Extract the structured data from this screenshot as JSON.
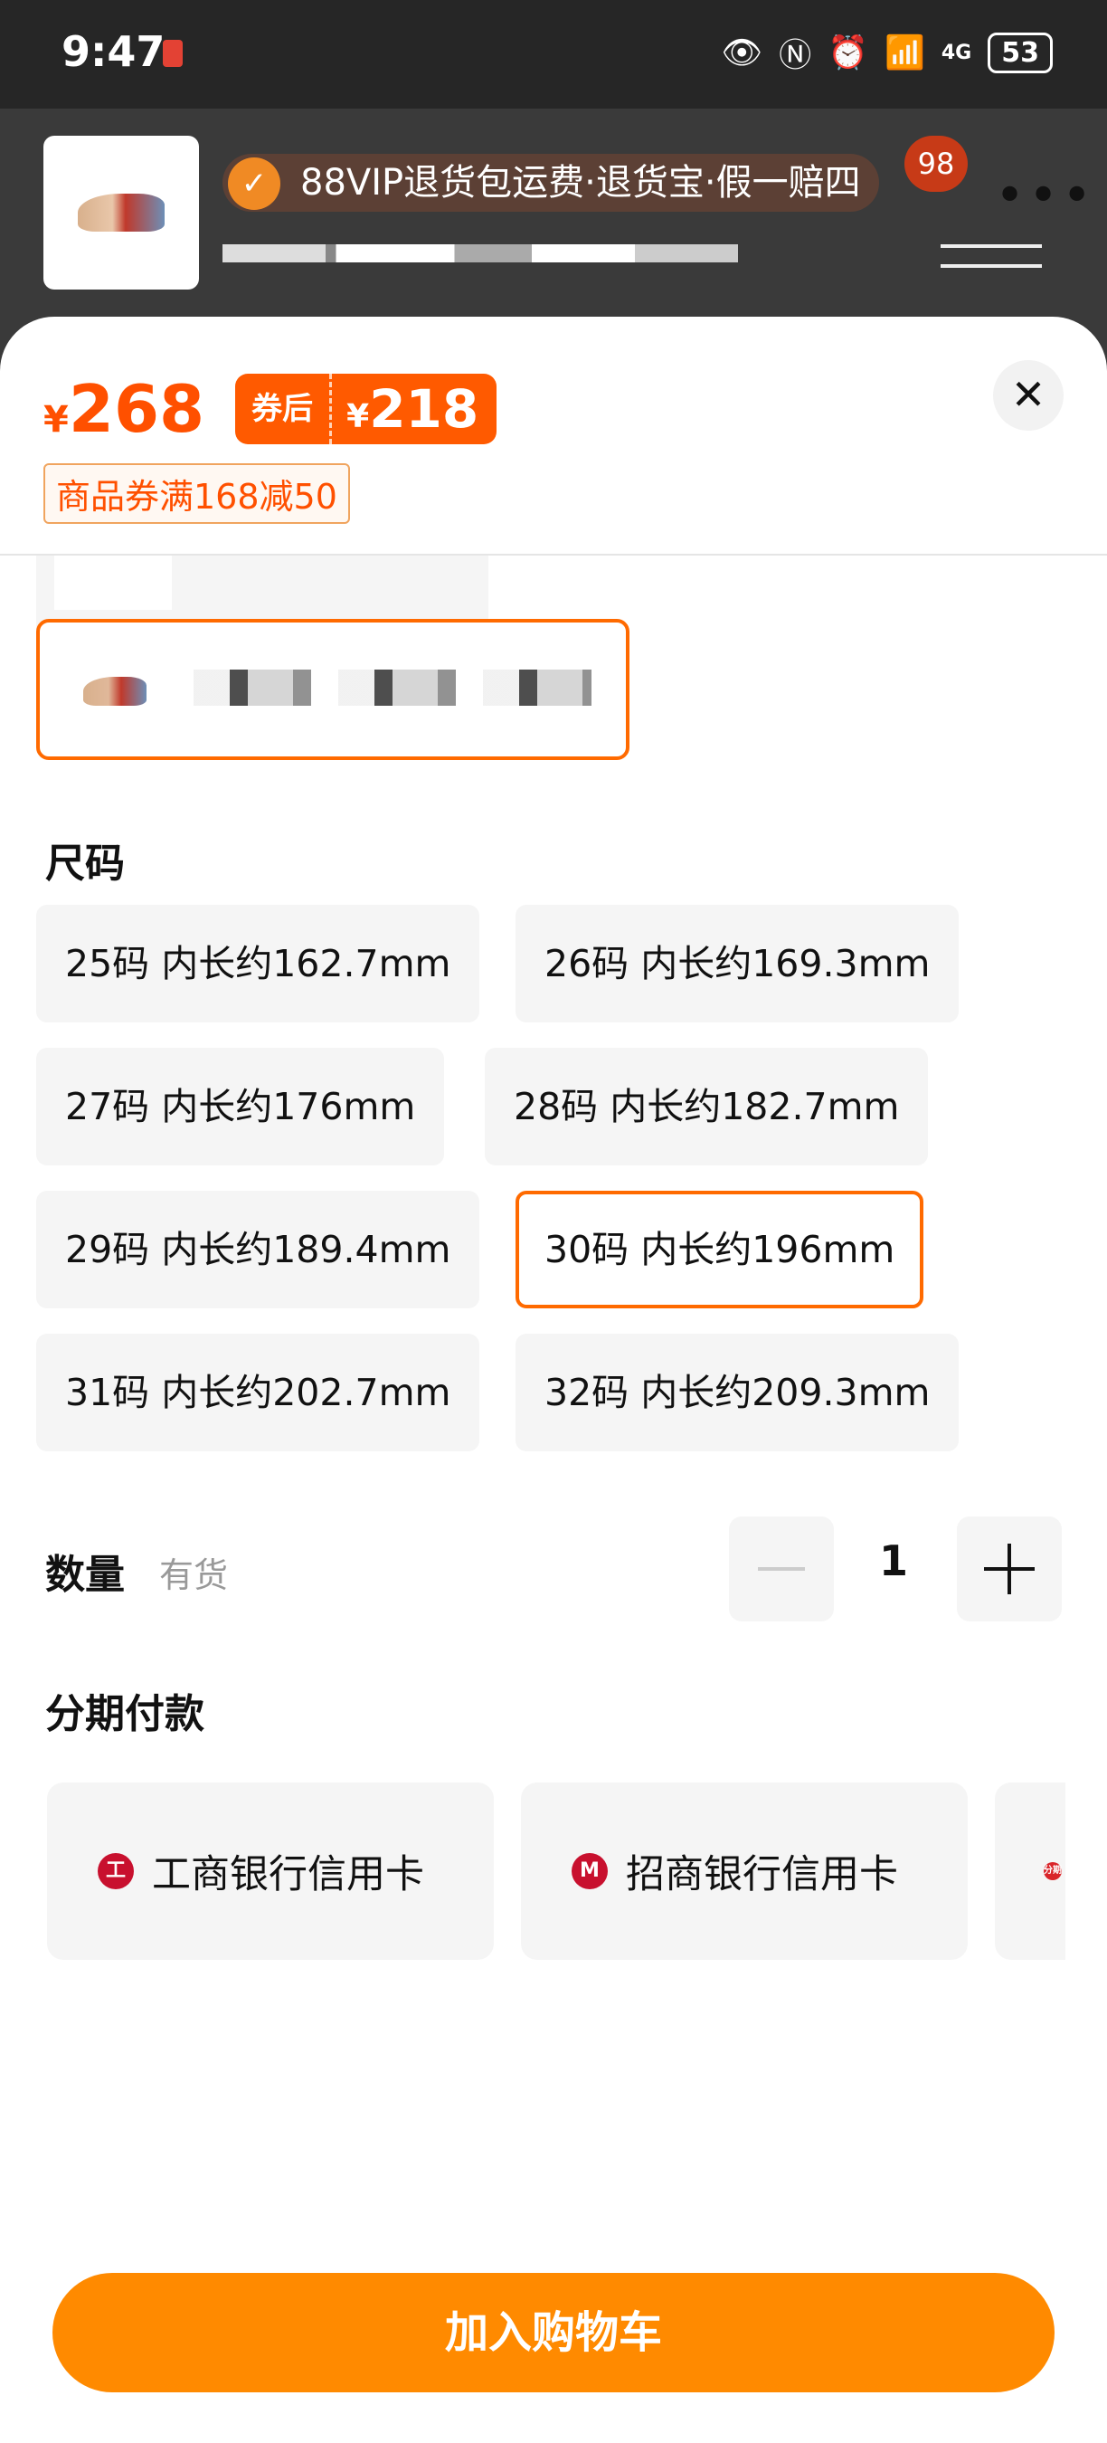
{
  "status_bar": {
    "time": "9:47",
    "battery": "53",
    "signal": "4G"
  },
  "header": {
    "vip_banner": "88VIP退货包运费·退货宝·假一赔四",
    "cart_count": "98"
  },
  "sheet": {
    "price": {
      "currency": "¥",
      "original": "268"
    },
    "coupon": {
      "label": "券后",
      "currency": "¥",
      "price": "218"
    },
    "coupon_note": "商品券满168减50",
    "close_label": "✕"
  },
  "size": {
    "title": "尺码",
    "options": [
      {
        "label": "25码 内长约162.7mm",
        "selected": false
      },
      {
        "label": "26码 内长约169.3mm",
        "selected": false
      },
      {
        "label": "27码 内长约176mm",
        "selected": false
      },
      {
        "label": "28码 内长约182.7mm",
        "selected": false
      },
      {
        "label": "29码 内长约189.4mm",
        "selected": false
      },
      {
        "label": "30码 内长约196mm",
        "selected": true
      },
      {
        "label": "31码 内长约202.7mm",
        "selected": false
      },
      {
        "label": "32码 内长约209.3mm",
        "selected": false
      }
    ]
  },
  "quantity": {
    "label": "数量",
    "stock": "有货",
    "value": "1"
  },
  "installment": {
    "title": "分期付款",
    "cards": [
      {
        "label": "工商银行信用卡",
        "icon": "icbc-logo-icon",
        "color": "#c8102e"
      },
      {
        "label": "招商银行信用卡",
        "icon": "cmb-logo-icon",
        "color": "#c8102e"
      },
      {
        "label": "分期",
        "icon": "installment-logo-icon",
        "color": "#d9252a"
      }
    ]
  },
  "add_to_cart": "加入购物车",
  "colors": {
    "accent": "#ff5000",
    "cta": "#ff8a00",
    "selected_border": "#ff6a00"
  }
}
